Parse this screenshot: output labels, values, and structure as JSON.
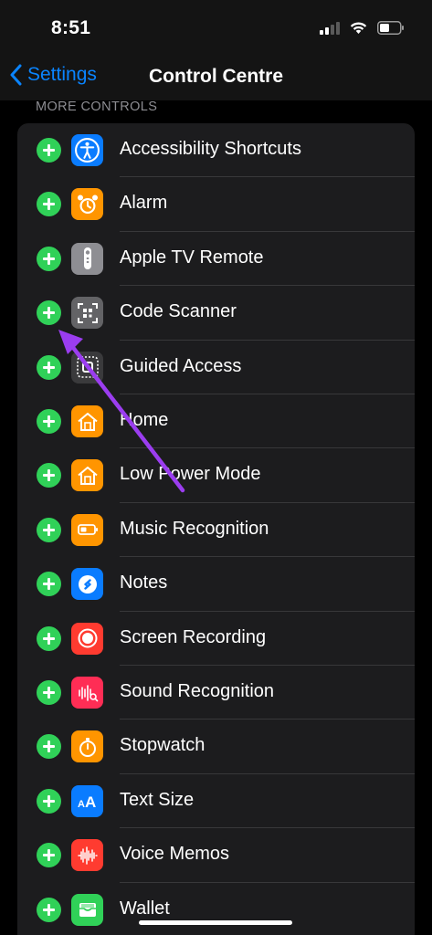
{
  "status_bar": {
    "time": "8:51"
  },
  "nav": {
    "back_label": "Settings",
    "title": "Control Centre"
  },
  "section_header": "MORE CONTROLS",
  "colors": {
    "add_green": "#30d158",
    "link_blue": "#0a84ff",
    "annotation_purple": "#9b3df0",
    "row_background": "#1c1c1e"
  },
  "controls": [
    {
      "label": "Accessibility Shortcuts",
      "icon": "accessibility-icon",
      "color": "#0a7cff"
    },
    {
      "label": "Alarm",
      "icon": "alarm-clock-icon",
      "color": "#ff9500"
    },
    {
      "label": "Apple TV Remote",
      "icon": "tv-remote-icon",
      "color": "#8e8e93"
    },
    {
      "label": "Code Scanner",
      "icon": "qr-code-icon",
      "color": "#636366"
    },
    {
      "label": "Guided Access",
      "icon": "guided-access-icon",
      "color": "#3a3a3c"
    },
    {
      "label": "Home",
      "icon": "home-icon",
      "color": "#ff9500"
    },
    {
      "label": "Low Power Mode",
      "icon": "home-icon",
      "color": "#ff9500"
    },
    {
      "label": "Music Recognition",
      "icon": "battery-icon",
      "color": "#ff9500"
    },
    {
      "label": "Notes",
      "icon": "shazam-icon",
      "color": "#0a7cff"
    },
    {
      "label": "Screen Recording",
      "icon": "record-icon",
      "color": "#ff3b30"
    },
    {
      "label": "Sound Recognition",
      "icon": "sound-recognition-icon",
      "color": "#ff2d55"
    },
    {
      "label": "Stopwatch",
      "icon": "stopwatch-icon",
      "color": "#ff9500"
    },
    {
      "label": "Text Size",
      "icon": "text-size-icon",
      "color": "#0a7cff"
    },
    {
      "label": "Voice Memos",
      "icon": "waveform-icon",
      "color": "#ff3b30"
    },
    {
      "label": "Wallet",
      "icon": "wallet-icon",
      "color": "#30d158"
    }
  ]
}
